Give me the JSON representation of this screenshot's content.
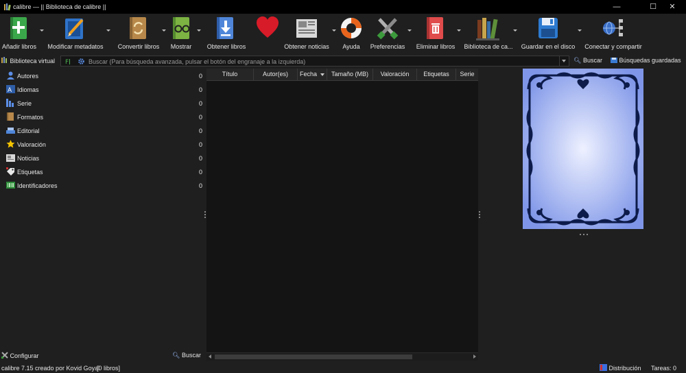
{
  "window": {
    "title": "calibre — || Biblioteca de calibre ||",
    "minimize": "—",
    "maximize": "☐",
    "close": "✕"
  },
  "toolbar": {
    "items": [
      {
        "label": "Añadir libros",
        "icon": "add-books-icon",
        "dropdown": true
      },
      {
        "label": "Modificar metadatos",
        "icon": "edit-metadata-icon",
        "dropdown": true
      },
      {
        "label": "Convertir libros",
        "icon": "convert-books-icon",
        "dropdown": true
      },
      {
        "label": "Mostrar",
        "icon": "view-book-icon",
        "dropdown": true
      },
      {
        "label": "Obtener libros",
        "icon": "get-books-icon",
        "dropdown": false
      },
      {
        "label": "",
        "icon": "donate-heart-icon",
        "dropdown": false
      },
      {
        "label": "Obtener noticias",
        "icon": "fetch-news-icon",
        "dropdown": true
      },
      {
        "label": "Ayuda",
        "icon": "help-lifebuoy-icon",
        "dropdown": false
      },
      {
        "label": "Preferencias",
        "icon": "preferences-tools-icon",
        "dropdown": true
      },
      {
        "label": "Eliminar libros",
        "icon": "remove-books-icon",
        "dropdown": true
      },
      {
        "label": "Biblioteca de ca...",
        "icon": "library-icon",
        "dropdown": true
      },
      {
        "label": "Guardar en el disco",
        "icon": "save-to-disk-icon",
        "dropdown": true
      },
      {
        "label": "Conectar y compartir",
        "icon": "connect-share-icon",
        "dropdown": false
      }
    ]
  },
  "search": {
    "virtual_library": "Biblioteca virtual",
    "placeholder": "Buscar (Para búsqueda avanzada, pulsar el botón del engranaje a la izquierda)",
    "search_button": "Buscar",
    "saved_searches": "Búsquedas guardadas"
  },
  "tag_browser": {
    "categories": [
      {
        "label": "Autores",
        "count": "0",
        "icon": "authors-icon"
      },
      {
        "label": "Idiomas",
        "count": "0",
        "icon": "languages-icon"
      },
      {
        "label": "Serie",
        "count": "0",
        "icon": "series-icon"
      },
      {
        "label": "Formatos",
        "count": "0",
        "icon": "formats-icon"
      },
      {
        "label": "Editorial",
        "count": "0",
        "icon": "publisher-icon"
      },
      {
        "label": "Valoración",
        "count": "0",
        "icon": "rating-star-icon"
      },
      {
        "label": "Noticias",
        "count": "0",
        "icon": "news-icon"
      },
      {
        "label": "Etiquetas",
        "count": "0",
        "icon": "tags-icon"
      },
      {
        "label": "Identificadores",
        "count": "0",
        "icon": "identifiers-icon"
      }
    ],
    "configure": "Configurar",
    "find": "Buscar"
  },
  "book_list": {
    "columns": [
      "Título",
      "Autor(es)",
      "Fecha",
      "Tamaño (MB)",
      "Valoración",
      "Etiquetas",
      "Serie"
    ],
    "sorted_column": "Fecha"
  },
  "status": {
    "left": "calibre 7.15 creado por Kovid Goyal",
    "book_count": "[0 libros]",
    "layout": "Distribución",
    "jobs": "Tareas: 0"
  },
  "colors": {
    "background": "#1f1f1f",
    "titlebar": "#000000",
    "book_list_bg": "#141414",
    "cover_blue": "#8fa4ee",
    "cover_ornament": "#0d1b4a"
  }
}
